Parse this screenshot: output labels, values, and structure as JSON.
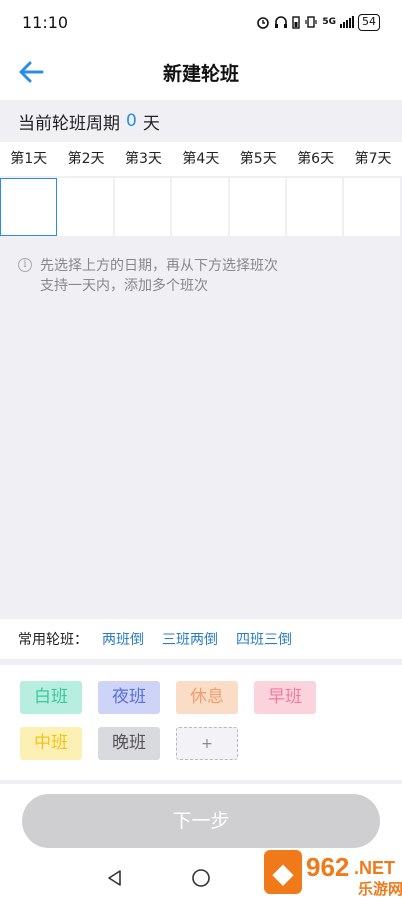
{
  "status_bar": {
    "time": "11:10",
    "network": "5G",
    "battery": "54"
  },
  "header": {
    "title": "新建轮班"
  },
  "cycle": {
    "prefix": "当前轮班周期",
    "count": "0",
    "suffix": "天"
  },
  "days": [
    "第1天",
    "第2天",
    "第3天",
    "第4天",
    "第5天",
    "第6天",
    "第7天"
  ],
  "hint": {
    "line1": "先选择上方的日期，再从下方选择班次",
    "line2": "支持一天内，添加多个班次"
  },
  "common": {
    "label": "常用轮班：",
    "options": [
      "两班倒",
      "三班两倒",
      "四班三倒"
    ]
  },
  "shifts": [
    {
      "label": "白班",
      "bg": "#b8eedf",
      "color": "#3cc79b"
    },
    {
      "label": "夜班",
      "bg": "#cdd4f7",
      "color": "#5b6fd8"
    },
    {
      "label": "休息",
      "bg": "#fbdcc7",
      "color": "#f0a070"
    },
    {
      "label": "早班",
      "bg": "#fbd3dc",
      "color": "#f07e98"
    },
    {
      "label": "中班",
      "bg": "#fdf0b4",
      "color": "#f2c418"
    },
    {
      "label": "晚班",
      "bg": "#d9dadd",
      "color": "#555555"
    }
  ],
  "add_shift": "+",
  "next_button": "下一步",
  "watermark": {
    "text1": "962",
    "text2": ".NET",
    "text3": "乐游网"
  },
  "colors": {
    "accent": "#2a8ee0",
    "background": "#efeff4"
  }
}
